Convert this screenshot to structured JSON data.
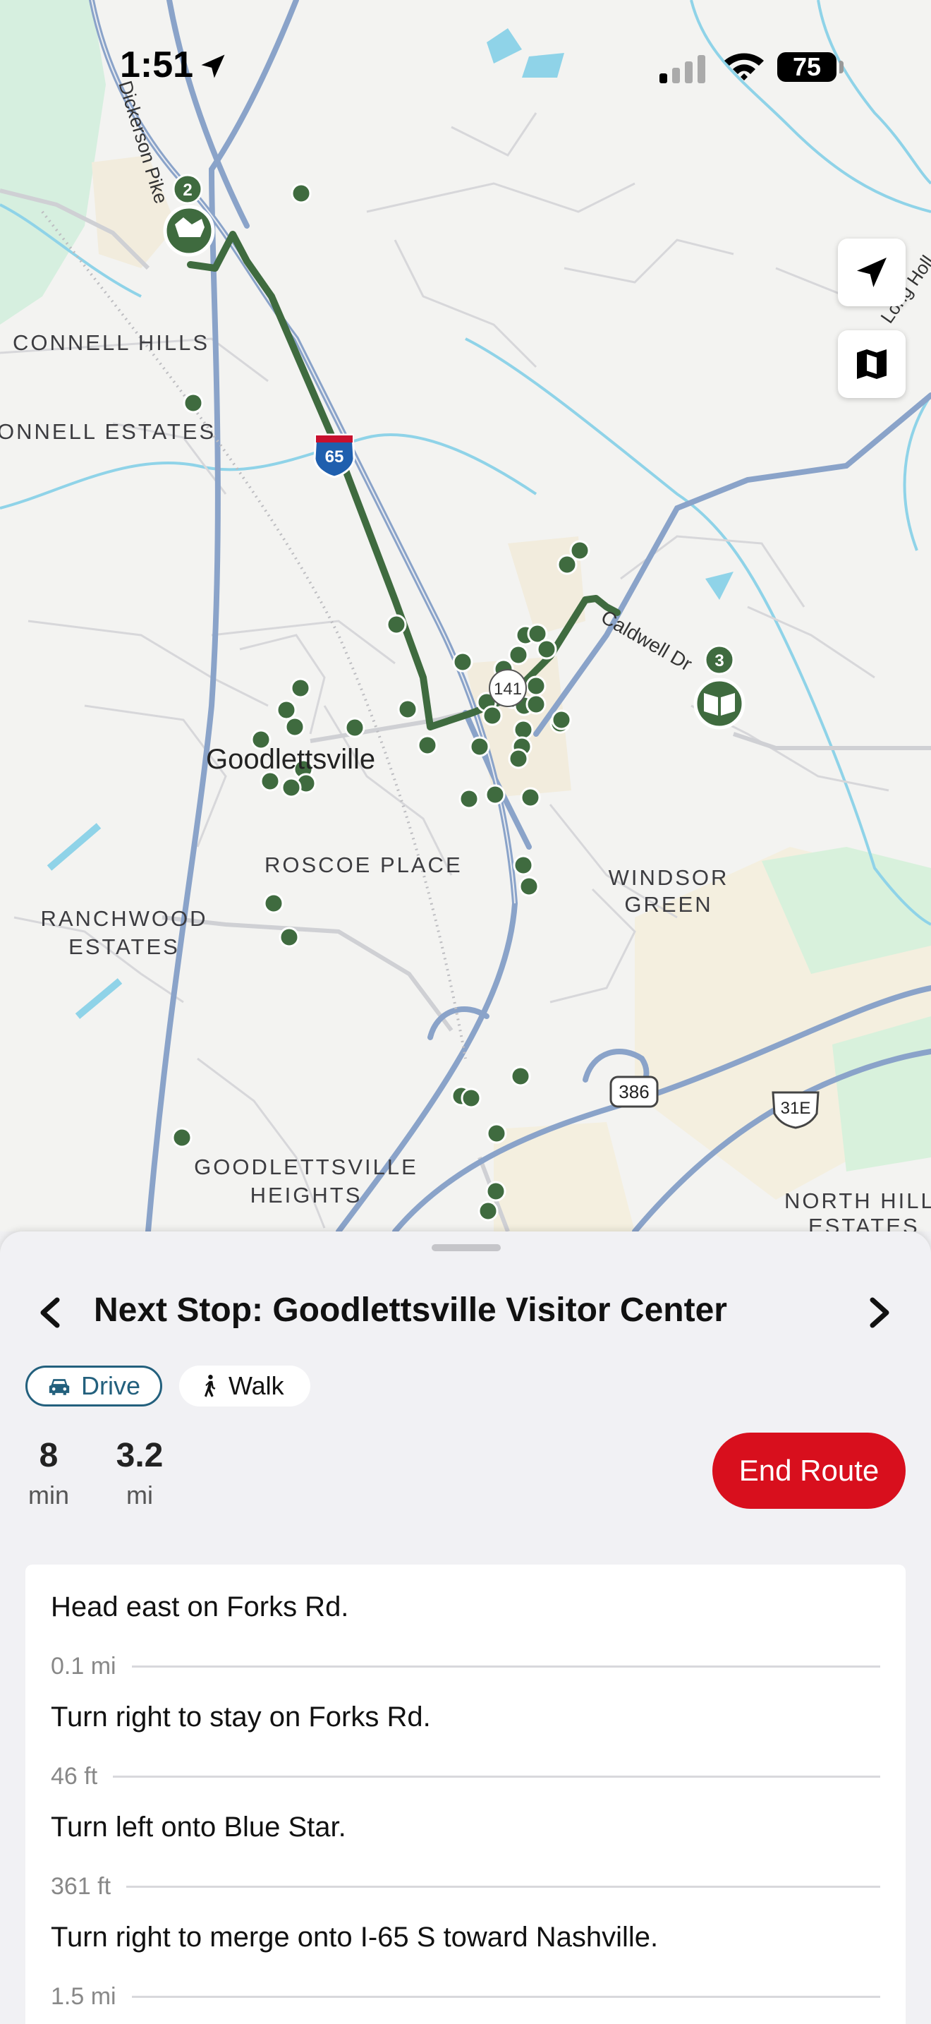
{
  "status_bar": {
    "time": "1:51",
    "battery": "75"
  },
  "map": {
    "labels": {
      "connell_hills": "CONNELL HILLS",
      "connell_estates": "ONNELL ESTATES",
      "goodlettsville": "Goodlettsville",
      "roscoe_place": "ROSCOE PLACE",
      "ranchwood_1": "RANCHWOOD",
      "ranchwood_2": "ESTATES",
      "windsor_1": "WINDSOR",
      "windsor_2": "GREEN",
      "heights_1": "GOODLETTSVILLE",
      "heights_2": "HEIGHTS",
      "north_hills_1": "NORTH HILLS",
      "north_hills_2": "ESTATES",
      "dickerson_pike": "Dickerson Pike",
      "caldwell_dr": "Caldwell Dr",
      "long_hollow": "Long Holl",
      "shield_i65": "65",
      "shield_386": "386",
      "shield_31e": "31E",
      "route_marker_141": "141",
      "stop2": "2",
      "stop3": "3"
    },
    "colors": {
      "route": "#3f6b3f",
      "poi": "#3f6b3f",
      "highway": "#8aa3c9",
      "water": "#8fd3e8"
    }
  },
  "sheet": {
    "title": "Next Stop: Goodlettsville Visitor Center",
    "modes": {
      "drive": "Drive",
      "walk": "Walk"
    },
    "time_value": "8",
    "time_unit": "min",
    "distance_value": "3.2",
    "distance_unit": "mi",
    "end_button": "End Route",
    "directions": [
      {
        "text": "Head east on Forks Rd.",
        "distance": "0.1 mi"
      },
      {
        "text": "Turn right to stay on Forks Rd.",
        "distance": "46 ft"
      },
      {
        "text": "Turn left onto Blue Star.",
        "distance": "361 ft"
      },
      {
        "text": "Turn right to merge onto I-65 S toward Nashville.",
        "distance": "1.5 mi"
      }
    ]
  }
}
